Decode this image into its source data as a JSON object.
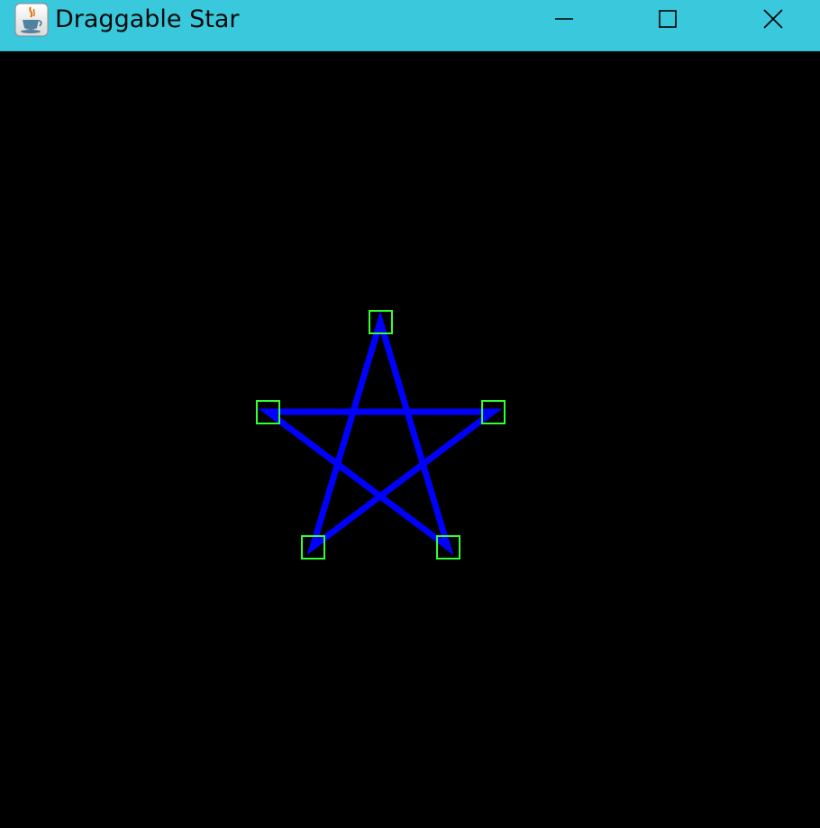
{
  "window": {
    "title": "Draggable Star",
    "app_icon": "java-cup-icon",
    "controls": {
      "minimize_icon": "minimize-icon",
      "maximize_icon": "maximize-icon",
      "close_icon": "close-icon"
    }
  },
  "colors": {
    "titlebar": "#3ac8dc",
    "canvas_background": "#000000",
    "star_stroke": "#0000ff",
    "handle_stroke": "#33ff33"
  },
  "star": {
    "point_count": 5,
    "handle_count": 5
  }
}
